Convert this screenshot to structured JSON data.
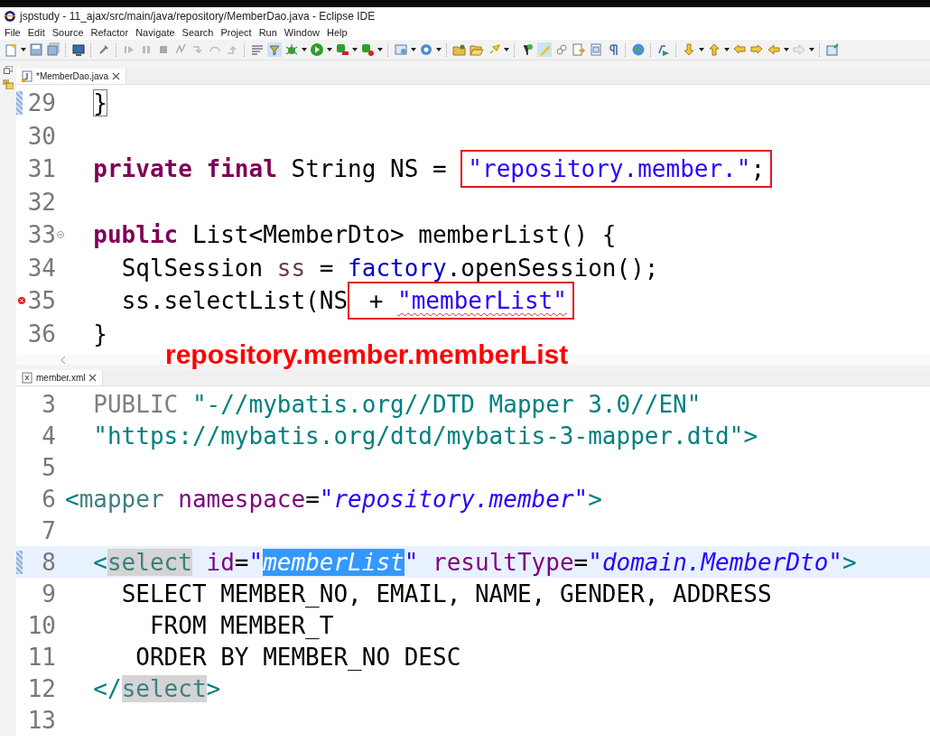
{
  "window": {
    "title": "jspstudy - 11_ajax/src/main/java/repository/MemberDao.java - Eclipse IDE"
  },
  "menu": [
    "File",
    "Edit",
    "Source",
    "Refactor",
    "Navigate",
    "Search",
    "Project",
    "Run",
    "Window",
    "Help"
  ],
  "editors": [
    {
      "tab": {
        "label": "*MemberDao.java",
        "kind": "java"
      },
      "lines": [
        {
          "number": "29",
          "marker": true,
          "tokens": [
            {
              "text": "  }",
              "kind": "bracket"
            }
          ]
        },
        {
          "number": "30"
        },
        {
          "number": "31",
          "tokens": [
            {
              "text": "  private",
              "kind": "kw"
            },
            {
              "text": " final",
              "kind": "kw"
            },
            {
              "text": " String NS = ",
              "kind": "plain"
            },
            {
              "text": "\"repository.member.\"",
              "kind": "str",
              "boxed": true
            },
            {
              "text": ";",
              "kind": "plain",
              "boxed": true
            }
          ]
        },
        {
          "number": "32"
        },
        {
          "number": "33",
          "fold": true,
          "tokens": [
            {
              "text": "  public",
              "kind": "kw"
            },
            {
              "text": " List<MemberDto> memberList() {",
              "kind": "plain"
            }
          ]
        },
        {
          "number": "34",
          "tokens": [
            {
              "text": "    SqlSession ",
              "kind": "plain"
            },
            {
              "text": "ss",
              "kind": "local"
            },
            {
              "text": " = ",
              "kind": "plain"
            },
            {
              "text": "factory",
              "kind": "field"
            },
            {
              "text": ".openSession();",
              "kind": "plain"
            }
          ]
        },
        {
          "number": "35",
          "error": true,
          "tokens": [
            {
              "text": "    ss.selectList(NS",
              "kind": "plain"
            },
            {
              "text": " + ",
              "kind": "plain",
              "boxed": true
            },
            {
              "text": "\"memberList\"",
              "kind": "errstr",
              "boxed": true
            }
          ]
        },
        {
          "number": "36",
          "tokens": [
            {
              "text": "  }",
              "kind": "plain"
            }
          ]
        }
      ]
    },
    {
      "tab": {
        "label": "member.xml",
        "kind": "xml"
      },
      "lines": [
        {
          "number": "3",
          "tokens": [
            {
              "text": "  PUBLIC ",
              "kind": "doctype"
            },
            {
              "text": "\"-//mybatis.org//DTD Mapper 3.0//EN\"",
              "kind": "dtdstr"
            }
          ]
        },
        {
          "number": "4",
          "tokens": [
            {
              "text": "  \"https://mybatis.org/dtd/mybatis-3-mapper.dtd\"",
              "kind": "dtdstr"
            },
            {
              "text": ">",
              "kind": "punct"
            }
          ]
        },
        {
          "number": "5"
        },
        {
          "number": "6",
          "tokens": [
            {
              "text": "<",
              "kind": "punct"
            },
            {
              "text": "mapper",
              "kind": "tag"
            },
            {
              "text": " namespace",
              "kind": "attr"
            },
            {
              "text": "=",
              "kind": "plain"
            },
            {
              "text": "\"repository.member\"",
              "kind": "val"
            },
            {
              "text": ">",
              "kind": "punct"
            }
          ]
        },
        {
          "number": "7"
        },
        {
          "number": "8",
          "marker": true,
          "current": true,
          "tokens": [
            {
              "text": "  <",
              "kind": "punct"
            },
            {
              "text": "select",
              "kind": "tagmatch"
            },
            {
              "text": " id",
              "kind": "attr"
            },
            {
              "text": "=",
              "kind": "plain"
            },
            {
              "text": "\"",
              "kind": "val"
            },
            {
              "text": "memberList",
              "kind": "selected"
            },
            {
              "text": "\"",
              "kind": "val"
            },
            {
              "text": " resultType",
              "kind": "attr"
            },
            {
              "text": "=",
              "kind": "plain"
            },
            {
              "text": "\"domain.MemberDto\"",
              "kind": "val"
            },
            {
              "text": ">",
              "kind": "punct"
            }
          ]
        },
        {
          "number": "9",
          "tokens": [
            {
              "text": "    SELECT MEMBER_NO, EMAIL, NAME, GENDER, ADDRESS",
              "kind": "plain"
            }
          ]
        },
        {
          "number": "10",
          "tokens": [
            {
              "text": "      FROM MEMBER_T",
              "kind": "plain"
            }
          ]
        },
        {
          "number": "11",
          "tokens": [
            {
              "text": "     ORDER BY MEMBER_NO DESC",
              "kind": "plain"
            }
          ]
        },
        {
          "number": "12",
          "tokens": [
            {
              "text": "  </",
              "kind": "punct"
            },
            {
              "text": "select",
              "kind": "tagmatch"
            },
            {
              "text": ">",
              "kind": "punct"
            }
          ]
        },
        {
          "number": "13"
        }
      ]
    }
  ],
  "callout": {
    "text": "repository.member.memberList"
  }
}
